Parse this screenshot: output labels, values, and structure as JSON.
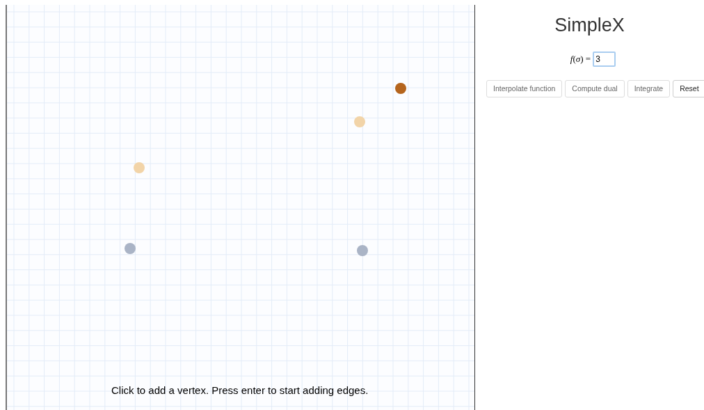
{
  "canvas": {
    "vertices": [
      {
        "color": "#b5651d"
      },
      {
        "color": "#f2d4a8"
      },
      {
        "color": "#f2d4a8"
      },
      {
        "color": "#aab4c6"
      },
      {
        "color": "#aab4c6"
      }
    ],
    "instruction": "Click to add a vertex. Press enter to start adding edges."
  },
  "panel": {
    "title": "SimpleX",
    "function_label": "*f*(*σ*) =",
    "function_value": "3",
    "buttons": [
      "Interpolate function",
      "Compute dual",
      "Integrate",
      "Reset"
    ]
  }
}
